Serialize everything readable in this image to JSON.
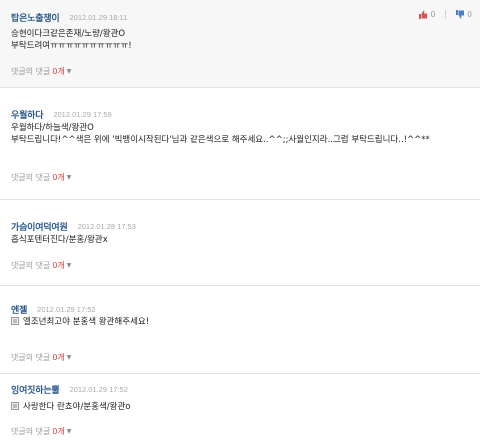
{
  "comments": [
    {
      "author": "탑은노출쟁이",
      "date": "2012.01.29 18:11",
      "up": "0",
      "down": "0",
      "lines": [
        "승현이다크같은존재/노량/왕관O",
        "부탁드려여ㅠㅠㅠㅠㅠㅠㅠㅠㅠㅠ!"
      ],
      "reply_label": "댓글의 댓글",
      "reply_count": "0개"
    },
    {
      "author": "우월하다",
      "date": "2012.01.29 17:59",
      "up": "0",
      "down": "0",
      "lines": [
        "우월하다/하늘색/왕관O",
        "부탁드립니다!^^색은 위에 '빅뱅이시작된다'님과 같은색으로 해주세요..^^;;사월인지라..그럼 부탁드립니다..!^^**"
      ],
      "reply_label": "댓글의 댓글",
      "reply_count": "0개"
    },
    {
      "author": "가슴이여덕여원",
      "date": "2012.01.28 17:53",
      "up": "0",
      "down": "0",
      "lines": [
        "흡식포텐터진다/분홍/왕관x"
      ],
      "reply_label": "댓글의 댓글",
      "reply_count": "0개"
    },
    {
      "author": "엔젤",
      "date": "2012.01.29 17:52",
      "up": "0",
      "down": "0",
      "lines": [
        "엘조년최고야 분홍색 왕관해주세요!"
      ],
      "reply_label": "댓글의 댓글",
      "reply_count": "0개"
    },
    {
      "author": "잉여짓하는뿔",
      "date": "2012.01.29 17:52",
      "up": "0",
      "down": "0",
      "lines": [
        "사랑한다 란쵸야/분홍색/왕관o"
      ],
      "reply_label": "댓글의 댓글",
      "reply_count": "0개"
    }
  ],
  "colors": {
    "author": "#2c5a8c",
    "up": "#d9534f",
    "down": "#4a7fc1",
    "reply_count": "#cc4444"
  },
  "icons": {
    "up": "thumbs-up-icon",
    "down": "thumbs-down-icon",
    "attachment": "image-thumbnail-icon",
    "caret": "caret-down-icon"
  }
}
